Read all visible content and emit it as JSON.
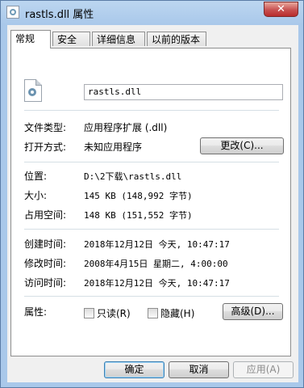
{
  "window": {
    "title": "rastls.dll 属性",
    "close_glyph": "✕"
  },
  "tabs": [
    "常规",
    "安全",
    "详细信息",
    "以前的版本"
  ],
  "general": {
    "file_name": "rastls.dll",
    "type_label": "文件类型:",
    "type_value": "应用程序扩展 (.dll)",
    "opens_label": "打开方式:",
    "opens_value": "未知应用程序",
    "change_button": "更改(C)...",
    "location_label": "位置:",
    "location_value": "D:\\2下载\\rastls.dll",
    "size_label": "大小:",
    "size_value": "145 KB (148,992 字节)",
    "disk_label": "占用空间:",
    "disk_value": "148 KB (151,552 字节)",
    "created_label": "创建时间:",
    "created_value": "2018年12月12日 今天, 10:47:17",
    "modified_label": "修改时间:",
    "modified_value": "2008年4月15日 星期二, 4:00:00",
    "accessed_label": "访问时间:",
    "accessed_value": "2018年12月12日 今天, 10:47:17",
    "attributes_label": "属性:",
    "readonly_label": "只读(R)",
    "readonly_checked": false,
    "hidden_label": "隐藏(H)",
    "hidden_checked": false,
    "advanced_button": "高级(D)..."
  },
  "footer": {
    "ok": "确定",
    "cancel": "取消",
    "apply": "应用(A)"
  },
  "icons": {
    "title": "dll-file-icon",
    "file": "dll-gear-file-icon"
  }
}
